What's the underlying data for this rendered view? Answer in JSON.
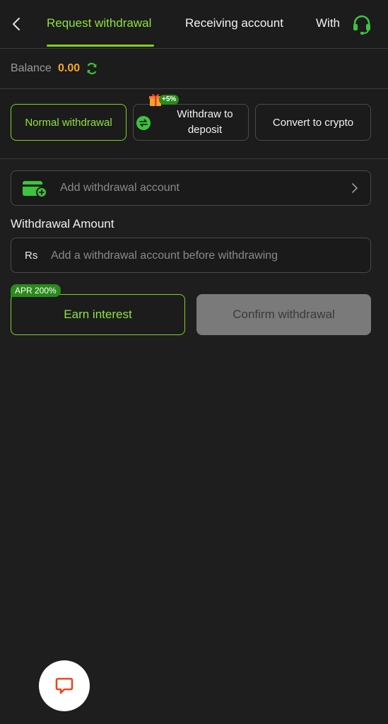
{
  "tabs": [
    {
      "label": "Request withdrawal",
      "active": true
    },
    {
      "label": "Receiving account",
      "active": false
    },
    {
      "label": "With",
      "active": false
    }
  ],
  "balance": {
    "label": "Balance",
    "value": "0.00"
  },
  "methods": [
    {
      "label": "Normal withdrawal",
      "active": true
    },
    {
      "label": "Withdraw to deposit",
      "badge": "+5%",
      "active": false
    },
    {
      "label": "Convert to crypto",
      "active": false
    }
  ],
  "account": {
    "label": "Add withdrawal account"
  },
  "amount": {
    "title": "Withdrawal Amount",
    "currency": "Rs",
    "placeholder": "Add a withdrawal account before withdrawing"
  },
  "actions": {
    "apr_badge": "APR 200%",
    "earn_label": "Earn interest",
    "confirm_label": "Confirm withdrawal"
  },
  "colors": {
    "accent": "#7ed321",
    "balance": "#f5a623",
    "background": "#1e1e1e",
    "chat": "#e8491d"
  },
  "icons": {
    "back": "back-arrow-icon",
    "support": "headset-icon",
    "refresh": "refresh-icon",
    "swap": "swap-icon",
    "gift": "gift-icon",
    "wallet": "wallet-add-icon",
    "chevron": "chevron-right-icon",
    "chat": "chat-bubble-icon"
  }
}
